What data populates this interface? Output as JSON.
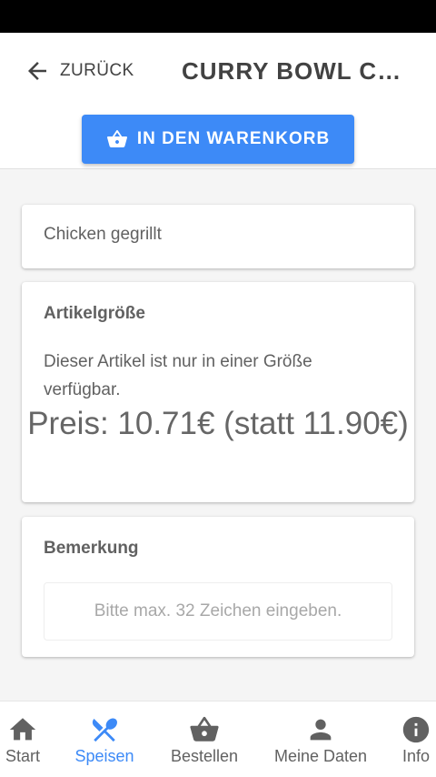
{
  "header": {
    "back_label": "ZURÜCK",
    "title": "CURRY BOWL CHICKEN",
    "cart_button_label": "IN DEN WARENKORB"
  },
  "item": {
    "name": "Chicken gegrillt"
  },
  "size_section": {
    "heading": "Artikelgröße",
    "description": "Dieser Artikel ist nur in einer Größe verfügbar.",
    "price_text": "Preis: 10.71€ (statt 11.90€)"
  },
  "remark_section": {
    "heading": "Bemerkung",
    "placeholder": "Bitte max. 32 Zeichen eingeben.",
    "value": ""
  },
  "bottom_nav": {
    "items": [
      {
        "label": "Start",
        "icon": "home-icon",
        "active": false
      },
      {
        "label": "Speisen",
        "icon": "cutlery-icon",
        "active": true
      },
      {
        "label": "Bestellen",
        "icon": "basket-icon",
        "active": false
      },
      {
        "label": "Meine Daten",
        "icon": "person-icon",
        "active": false
      },
      {
        "label": "Info",
        "icon": "info-icon",
        "active": false
      }
    ]
  },
  "colors": {
    "accent": "#3d8af7",
    "text": "#616161",
    "background": "#f5f5f5"
  }
}
